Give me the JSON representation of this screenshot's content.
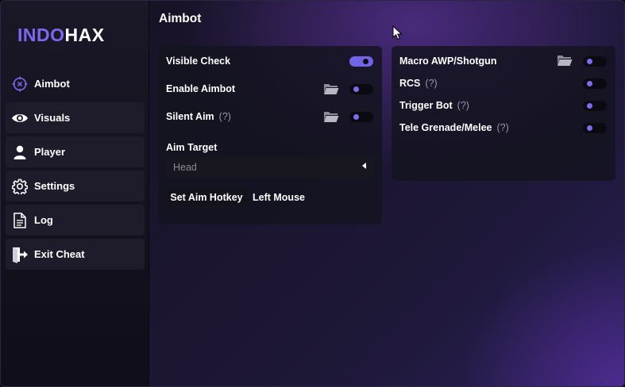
{
  "logo": {
    "part1": "INDO",
    "part2": "HAX"
  },
  "nav": {
    "items": [
      {
        "label": "Aimbot",
        "icon": "crosshair-icon",
        "active": true
      },
      {
        "label": "Visuals",
        "icon": "eye-icon"
      },
      {
        "label": "Player",
        "icon": "user-icon"
      },
      {
        "label": "Settings",
        "icon": "gear-icon"
      },
      {
        "label": "Log",
        "icon": "document-icon"
      },
      {
        "label": "Exit Cheat",
        "icon": "exit-door-icon"
      }
    ]
  },
  "page": {
    "title": "Aimbot"
  },
  "left_panel": {
    "visible_check": {
      "label": "Visible Check",
      "enabled": true
    },
    "enable_aimbot": {
      "label": "Enable Aimbot",
      "enabled": false
    },
    "silent_aim": {
      "label": "Silent Aim",
      "help": "(?)",
      "enabled": false
    },
    "aim_target": {
      "label": "Aim Target",
      "value": "Head"
    },
    "hotkey": {
      "button_label": "Set Aim Hotkey",
      "value": "Left Mouse"
    }
  },
  "right_panel": {
    "macro": {
      "label": "Macro AWP/Shotgun",
      "enabled": false
    },
    "rcs": {
      "label": "RCS",
      "help": "(?)",
      "enabled": false
    },
    "trigger_bot": {
      "label": "Trigger Bot",
      "help": "(?)",
      "enabled": false
    },
    "tele_grenade": {
      "label": "Tele Grenade/Melee",
      "help": "(?)",
      "enabled": false
    }
  },
  "colors": {
    "accent": "#7363e6",
    "background": "#14121e",
    "panel": "#14131e"
  }
}
